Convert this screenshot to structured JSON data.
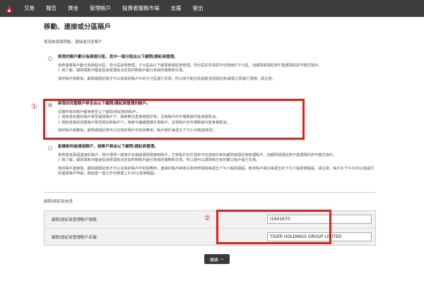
{
  "nav": {
    "items": [
      "交易",
      "報告",
      "資金",
      "管理帳戶",
      "投資者服務市場",
      "支援",
      "登出"
    ],
    "active_index": 3
  },
  "page": {
    "title": "移動、連接或分區賬戶",
    "intro": "使用該頁面移動、連接或分區賬戶"
  },
  "options": [
    {
      "heading": "將我的賬戶劃分為兩個分區，其中一個分區由以下顧問/經紀商管理。",
      "lines": [
        "我希望將賬戶劃分為兩個分區：母分區由我管理，子分區由以下顧問或經紀商管理。母分區的交易許可也適用於子分區，但顧問或經紀商不能選擇的許可模式除外。",
        "》我了解，顧問或對沖基金投資經理有決定如何對賬戶劃分為我的服務和交易。",
        "我的賬戶移動後，顧問或經紀商才可以為我的賬戶中的子分區進行交易，所以我不能在兩個或多個經紀商/顧問之間進行選擇，請注意。"
      ],
      "checked": false
    },
    {
      "heading": "將我的完整賬戶移至由以下顧問/經紀商管理的賬戶。",
      "lines": [
        "這樣所有的賬戶都會移至以下顧問/經紀商的賬戶。",
        "》我知道完整的賬戶移至顧問賬戶下，我將無法直接管理交易，且我賬戶的市場數據可能會被取消。",
        "》我知道我的完整賬戶移至經紀商賬戶下，我將可繼續登錄交易帳戶，且我賬戶的市場數據可能會被取消。",
        "我的賬戶移動後，顧問或經紀商可以在我的賬戶中扣除費用，賬戶將於每週五下午2:00點前移至。"
      ],
      "checked": true
    },
    {
      "heading": "創建新的被連接賬戶，該賬戶將由以下顧問/經紀商管理。",
      "lines": [
        "我希望有兩個連接的賬戶：我可選擇一組用戶名稱或選擇登錄新賬戶。已有賬戶的交易許可也適用於新的顧問或經紀商管理賬戶，但顧問或經紀商不能選擇的許可模式除外。",
        "》我了解，顧問或對沖基金投資經理有決定如何對賬戶劃分為我的服務和交易，所以我可以選擇我已有的獨立賬戶進行交易。",
        "我的賬戶連接後，顧問或經紀商才可以在我的賬戶中扣除費用，連接的賬戶將會在收到申請後每週五下午六點前開設。新的賬戶將在每週五的下午六點前被開設，請注意，帳戶在下午4:00以後提交的連接賬戶申請，將延遲一個工作日辦理上6:00以前被開設。"
      ],
      "checked": false
    }
  ],
  "advisor_section": {
    "label": "顧問/經紀商信息",
    "rows": [
      {
        "label": "顧問/經紀商管理賬戶號碼：",
        "value": "I1641670"
      },
      {
        "label": "顧問/經紀商管理賬戶名稱：",
        "value": "TIGER HOLDINGS GROUP LIMITED"
      }
    ]
  },
  "annotations": {
    "one": "①",
    "two": "②"
  },
  "continue_label": "繼續",
  "colors": {
    "nav_bg": "#3d3d3d",
    "highlight_red": "#e0201b",
    "logo_red": "#d9232a"
  }
}
